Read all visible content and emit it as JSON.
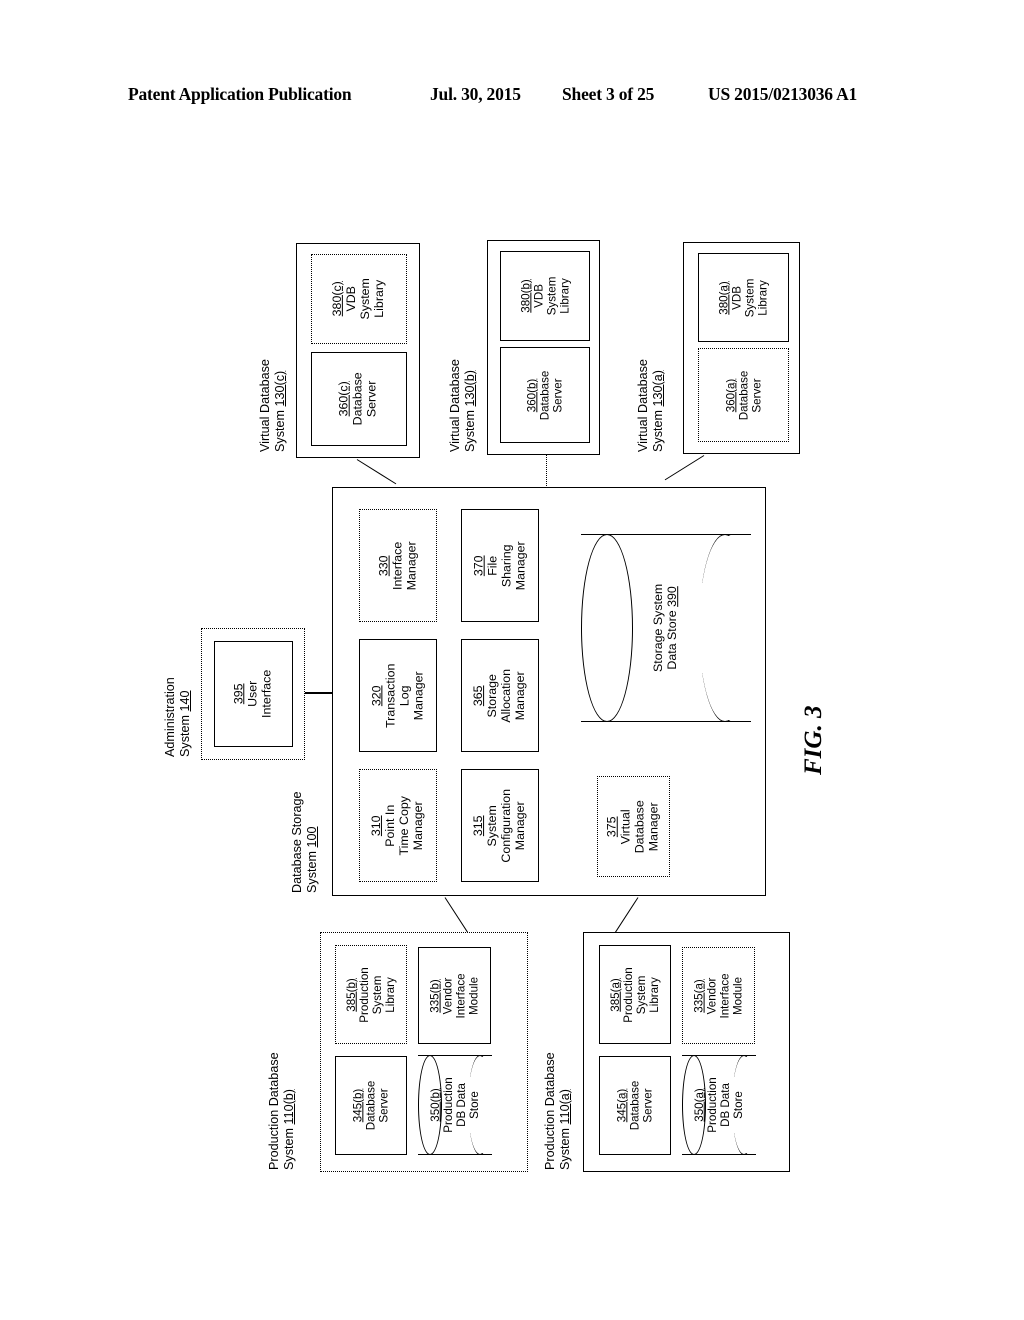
{
  "header": {
    "publication": "Patent Application Publication",
    "date": "Jul. 30, 2015",
    "sheet": "Sheet 3 of 25",
    "number": "US 2015/0213036 A1"
  },
  "figure": {
    "caption": "FIG. 3"
  },
  "virtual_database_systems": [
    {
      "label": "Virtual Database",
      "label_line2": "System ",
      "ref": "130(c)",
      "components": [
        {
          "ref": "380(c)",
          "name_line1": "VDB",
          "name_line2": "System",
          "name_line3": "Library"
        },
        {
          "ref": "360(c)",
          "name_line1": "Database",
          "name_line2": "Server",
          "name_line3": ""
        }
      ]
    },
    {
      "label": "Virtual Database",
      "label_line2": "System ",
      "ref": "130(b)",
      "components": [
        {
          "ref": "380(b)",
          "name_line1": "VDB",
          "name_line2": "System",
          "name_line3": "Library"
        },
        {
          "ref": "360(b)",
          "name_line1": "Database",
          "name_line2": "Server",
          "name_line3": ""
        }
      ]
    },
    {
      "label": "Virtual Database",
      "label_line2": "System ",
      "ref": "130(a)",
      "components": [
        {
          "ref": "380(a)",
          "name_line1": "VDB",
          "name_line2": "System",
          "name_line3": "Library"
        },
        {
          "ref": "360(a)",
          "name_line1": "Database",
          "name_line2": "Server",
          "name_line3": ""
        }
      ]
    }
  ],
  "administration_system": {
    "label_line1": "Administration",
    "label_line2": "System ",
    "ref": "140",
    "user_interface": {
      "ref": "395",
      "name_line1": "User",
      "name_line2": "Interface"
    }
  },
  "database_storage_system": {
    "label_line1": "Database Storage",
    "label_line2": "System ",
    "ref": "100",
    "managers": [
      {
        "ref": "330",
        "name_line1": "Interface",
        "name_line2": "Manager",
        "name_line3": ""
      },
      {
        "ref": "370",
        "name_line1": "File",
        "name_line2": "Sharing",
        "name_line3": "Manager"
      },
      {
        "ref": "320",
        "name_line1": "Transaction",
        "name_line2": "Log",
        "name_line3": "Manager"
      },
      {
        "ref": "365",
        "name_line1": "Storage",
        "name_line2": "Allocation",
        "name_line3": "Manager"
      },
      {
        "ref": "310",
        "name_line1": "Point In",
        "name_line2": "Time Copy",
        "name_line3": "Manager"
      },
      {
        "ref": "315",
        "name_line1": "System",
        "name_line2": "Configuration",
        "name_line3": "Manager"
      },
      {
        "ref": "375",
        "name_line1": "Virtual",
        "name_line2": "Database",
        "name_line3": "Manager"
      }
    ],
    "data_store": {
      "name_line1": "Storage System",
      "name_line2": "Data Store ",
      "ref": "390"
    }
  },
  "production_database_systems": [
    {
      "label_line1": "Production Database",
      "label_line2": "System ",
      "ref": "110(b)",
      "components": [
        {
          "ref": "385(b)",
          "name_line1": "Production",
          "name_line2": "System",
          "name_line3": "Library"
        },
        {
          "ref": "335(b)",
          "name_line1": "Vendor",
          "name_line2": "Interface",
          "name_line3": "Module"
        },
        {
          "ref": "345(b)",
          "name_line1": "Database",
          "name_line2": "Server",
          "name_line3": ""
        }
      ],
      "data_store": {
        "ref": "350(b)",
        "name_line1": "Production",
        "name_line2": "DB Data",
        "name_line3": "Store"
      }
    },
    {
      "label_line1": "Production Database",
      "label_line2": "System ",
      "ref": "110(a)",
      "components": [
        {
          "ref": "385(a)",
          "name_line1": "Production",
          "name_line2": "System",
          "name_line3": "Library"
        },
        {
          "ref": "335(a)",
          "name_line1": "Vendor",
          "name_line2": "Interface",
          "name_line3": "Module"
        },
        {
          "ref": "345(a)",
          "name_line1": "Database",
          "name_line2": "Server",
          "name_line3": ""
        }
      ],
      "data_store": {
        "ref": "350(a)",
        "name_line1": "Production",
        "name_line2": "DB Data",
        "name_line3": "Store"
      }
    }
  ]
}
